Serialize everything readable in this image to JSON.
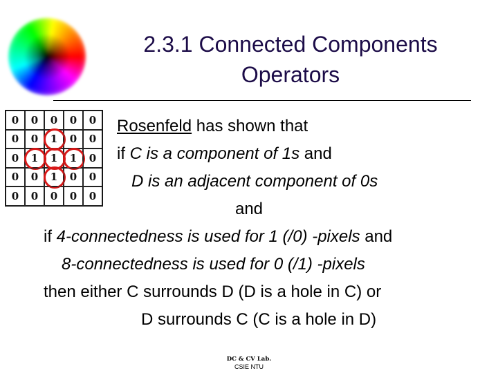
{
  "slide": {
    "title_line1": "2.3.1 Connected Components",
    "title_line2": "Operators",
    "title_color": "#1c0c48",
    "decoration": "color-wheel",
    "grid": {
      "rows": [
        [
          "0",
          "0",
          "0",
          "0",
          "0"
        ],
        [
          "0",
          "0",
          "1",
          "0",
          "0"
        ],
        [
          "0",
          "1",
          "1",
          "1",
          "0"
        ],
        [
          "0",
          "0",
          "1",
          "0",
          "0"
        ],
        [
          "0",
          "0",
          "0",
          "0",
          "0"
        ]
      ],
      "highlight_color": "#d81818"
    },
    "body": {
      "l1_name": "Rosenfeld",
      "l1_rest": " has shown that",
      "l2_a": "if ",
      "l2_b": "C is a component of 1s",
      "l2_c": " and",
      "l3": "D is an adjacent component of 0s",
      "l4": "and",
      "l5_a": "if ",
      "l5_b": "4-connectedness is used for 1 (/0) -pixels",
      "l5_c": " and",
      "l6": "8-connectedness is used for 0 (/1) -pixels",
      "l7": "then either C surrounds D (D is a hole in C) or",
      "l8": "D surrounds C (C is a hole in D)"
    },
    "footer": {
      "lab": "DC & CV Lab.",
      "org": "CSIE NTU"
    }
  }
}
